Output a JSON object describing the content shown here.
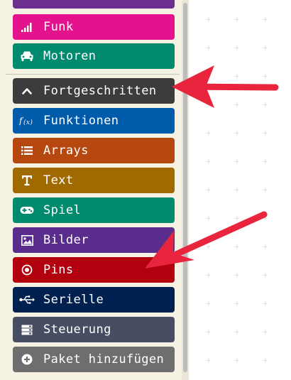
{
  "toolbox": {
    "categories": [
      {
        "label": "",
        "color": "#6b2f8f",
        "icon": "partial-category"
      },
      {
        "label": "Funk",
        "color": "#e4138d",
        "icon": "signal-bars-icon"
      },
      {
        "label": "Motoren",
        "color": "#008a6e",
        "icon": "car-icon"
      },
      {
        "label": "Fortgeschritten",
        "color": "#3c3c3c",
        "icon": "chevron-up-icon"
      },
      {
        "label": "Funktionen",
        "color": "#005bab",
        "icon": "function-icon"
      },
      {
        "label": "Arrays",
        "color": "#b5470f",
        "icon": "list-icon"
      },
      {
        "label": "Text",
        "color": "#a16a00",
        "icon": "text-icon"
      },
      {
        "label": "Spiel",
        "color": "#008a6e",
        "icon": "gamepad-icon"
      },
      {
        "label": "Bilder",
        "color": "#5a2d8c",
        "icon": "image-icon"
      },
      {
        "label": "Pins",
        "color": "#b3000f",
        "icon": "target-icon"
      },
      {
        "label": "Serielle",
        "color": "#002050",
        "icon": "usb-icon"
      },
      {
        "label": "Steuerung",
        "color": "#474e64",
        "icon": "control-icon"
      },
      {
        "label": "Paket hinzufügen",
        "color": "#6e6e6e",
        "icon": "plus-circle-icon"
      }
    ]
  },
  "annotations": {
    "arrow_color": "#e8253d"
  }
}
